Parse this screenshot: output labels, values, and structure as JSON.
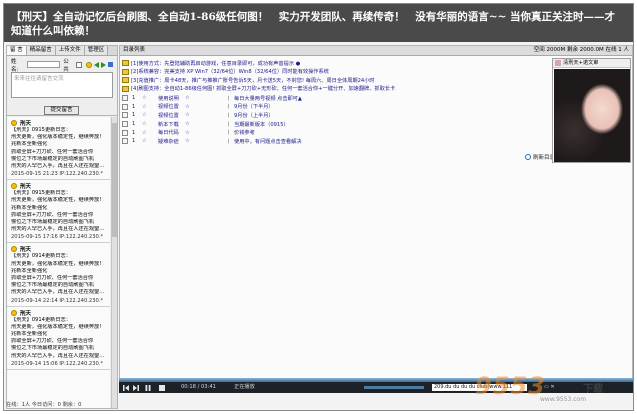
{
  "banner": {
    "text": "【刑天】全自动记忆后台刷图、全自动1-86级任何图！　实力开发团队、再续传奇！　没有华丽的语言~~ 当你真正关注时——才知道什么叫依赖！"
  },
  "left": {
    "tabs": [
      "留 言",
      "精品留言",
      "上传文件",
      "管理区"
    ],
    "name_label": "姓名:",
    "public_label": "公共",
    "placeholder": "来来往往请留言交流",
    "send_label": "提交留言",
    "posts": [
      {
        "title": "刑天",
        "lines": [
          "【刑天】0915更新日志：",
          "刑天更新，强化版本稳定性，继续奔放!",
          "兆新本全新强化",
          "抓取全屏+刀刀砍、任何一套活合你",
          "慢位之下市场最稳定的自动刷图飞机",
          "刑天的人罕已入手，再且在人还在观望…"
        ],
        "time": "2015-09-15 21:23 IP:122.240.230.*"
      },
      {
        "title": "刑天",
        "lines": [
          "【刑天】0915更新日志：",
          "刑天更新，强化版本稳定性，继续奔放!",
          "兆新本全新强化",
          "抓取全屏+刀刀砍、任何一套活合你",
          "慢位之下市场最稳定的自动刷图飞机",
          "刑天的人罕已入手，再且在人还在观望…"
        ],
        "time": "2015-09-15 17:16 IP:122.240.230.*"
      },
      {
        "title": "刑天",
        "lines": [
          "【刑天】0914更新日志：",
          "刑天更新，强化版本稳定性，继续奔放!",
          "兆新本全新强化",
          "抓取全屏+刀刀砍、任何一套活合你",
          "慢位之下市场最稳定的自动刷图飞机",
          "刑天的人罕已入手，再且在人还在观望…"
        ],
        "time": "2015-09-14 22:14 IP:122.240.230.*"
      },
      {
        "title": "刑天",
        "lines": [
          "【刑天】0914更新日志：",
          "刑天更新，强化版本稳定性，继续奔放!",
          "兆新本全新强化",
          "抓取全屏+刀刀砍、任何一套活合你",
          "慢位之下市场最稳定的自动刷图飞机",
          "刑天的人罕已入手，再且在人还在观望…"
        ],
        "time": "2015-09-14 15:06 IP:122.240.230.*"
      }
    ]
  },
  "main": {
    "header_left": "目录列表",
    "header_right": "空间 2000M  剩余 2000.0M  在线 1 人",
    "notices": [
      "[1]使用方式：先登陆辅助再启动游戏，任意目录即可，成功有声音提示 ●",
      "[2]系统兼容：完美支持 XP Win7（32/64位）Win8（32/64位）同时能有效操作系统",
      "[3]充值推广：周卡48天，推广与推推广账号告诉5天，月卡送5天，不封您! 每周六、周日全体周期24小时",
      "[4]刷图支持：全自动1-86级任何图! 抓取全屏+刀刀砍+无形砍、任何一套活合你+一键分开、加速翻牌、抓取长卡"
    ],
    "songs": [
      {
        "col1": "1",
        "col2": "☆",
        "col3": "使用说明",
        "col4": "☆",
        "col5": "",
        "col6": "丨",
        "col7": "每日大量两号视频 点击即可▲"
      },
      {
        "col1": "1",
        "col2": "☆",
        "col3": "视频位置",
        "col4": "☆",
        "col5": "",
        "col6": "丨",
        "col7": "9月份（下半月）"
      },
      {
        "col1": "1",
        "col2": "☆",
        "col3": "视频位置",
        "col4": "☆",
        "col5": "",
        "col6": "丨",
        "col7": "9月份（上半月）"
      },
      {
        "col1": "1",
        "col2": "☆",
        "col3": "新本下载",
        "col4": "☆",
        "col5": "",
        "col6": "丨",
        "col7": "当期最新版本（0915）"
      },
      {
        "col1": "1",
        "col2": "☆",
        "col3": "每日代码",
        "col4": "☆",
        "col5": "",
        "col6": "丨",
        "col7": "价钱参考"
      },
      {
        "col1": "1",
        "col2": "☆",
        "col3": "疑难杂症",
        "col4": "☆",
        "col5": "",
        "col6": "丨",
        "col7": "使用中，有问题点击查看解决"
      }
    ],
    "refresh_label": "刷新目录",
    "profile_caption": "清刑天+诺文审",
    "player": {
      "time": "00:18 / 03:41",
      "status": "正在播放",
      "now_playing": "209.du du du du club(www.111"
    }
  },
  "status": {
    "text": "在线：1人  今日访问：0  剩余：0"
  },
  "watermark": {
    "main": "9553",
    "sub": "下载",
    "url": "www.9553.com"
  }
}
